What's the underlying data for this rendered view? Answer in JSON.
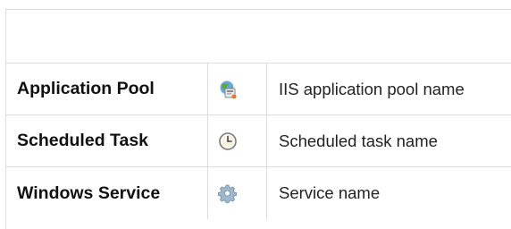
{
  "rows": [
    {
      "type": "Application Pool",
      "icon": "application-pool-icon",
      "description": "IIS application pool name"
    },
    {
      "type": "Scheduled Task",
      "icon": "clock-icon",
      "description": "Scheduled task name"
    },
    {
      "type": "Windows Service",
      "icon": "gear-icon",
      "description": "Service name"
    }
  ]
}
